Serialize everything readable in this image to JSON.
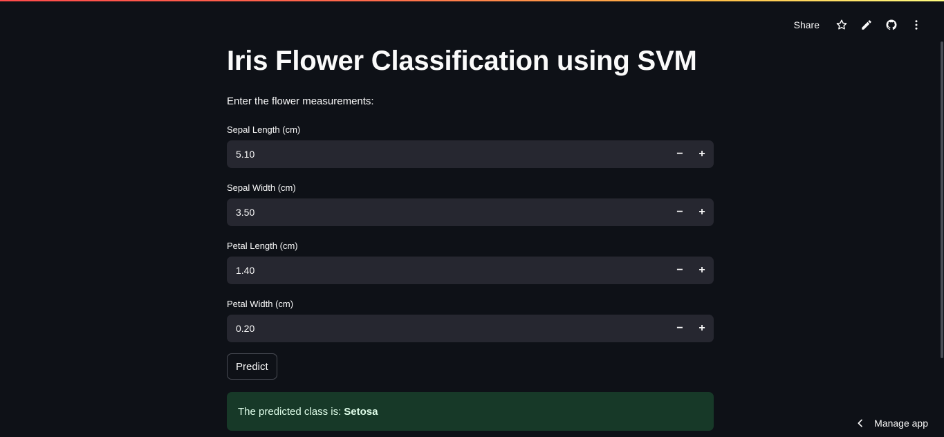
{
  "header": {
    "share_label": "Share",
    "icons": [
      "star-icon",
      "pencil-icon",
      "github-icon",
      "more-vert-icon"
    ]
  },
  "main": {
    "title": "Iris Flower Classification using SVM",
    "intro": "Enter the flower measurements:",
    "fields": [
      {
        "label": "Sepal Length (cm)",
        "value": "5.10"
      },
      {
        "label": "Sepal Width (cm)",
        "value": "3.50"
      },
      {
        "label": "Petal Length (cm)",
        "value": "1.40"
      },
      {
        "label": "Petal Width (cm)",
        "value": "0.20"
      }
    ],
    "stepper": {
      "minus": "−",
      "plus": "+"
    },
    "predict_label": "Predict",
    "result": {
      "prefix": "The predicted class is:",
      "value": "Setosa"
    }
  },
  "footer": {
    "manage_app_label": "Manage app"
  },
  "colors": {
    "background": "#0e1117",
    "input_bg": "#262730",
    "success_bg": "#173928",
    "success_text": "#dffde9"
  }
}
